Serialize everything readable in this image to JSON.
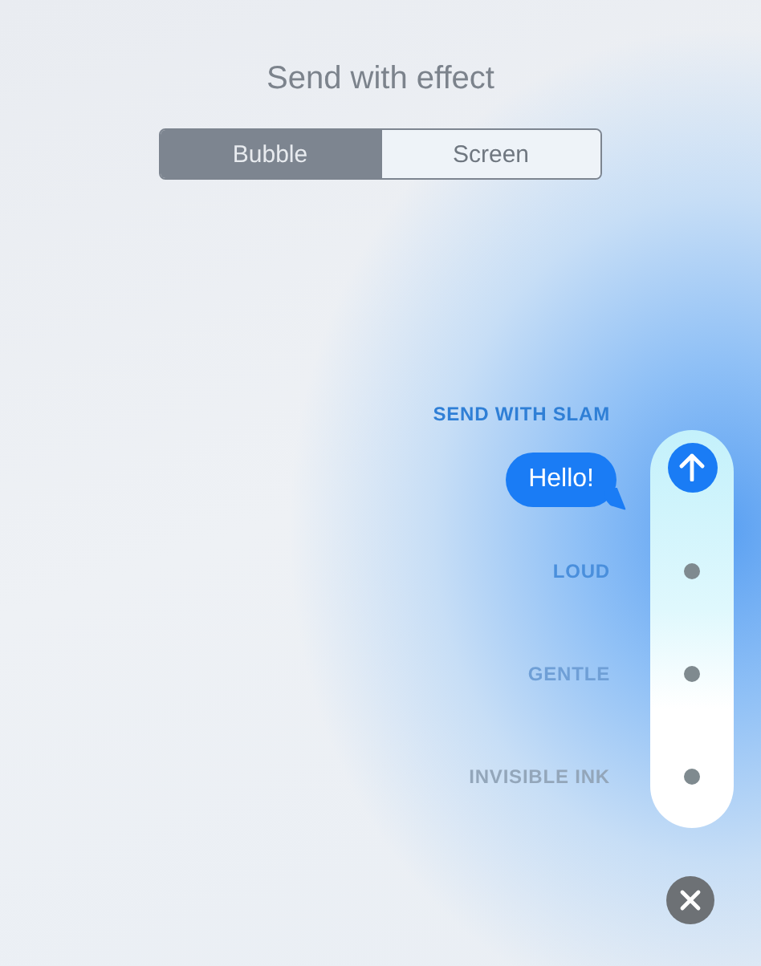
{
  "title": "Send with effect",
  "tabs": [
    {
      "label": "Bubble",
      "selected": true
    },
    {
      "label": "Screen",
      "selected": false
    }
  ],
  "effects": [
    {
      "label": "SEND WITH SLAM",
      "selected": true
    },
    {
      "label": "LOUD",
      "selected": false
    },
    {
      "label": "GENTLE",
      "selected": false
    },
    {
      "label": "INVISIBLE INK",
      "selected": false
    }
  ],
  "message": "Hello!"
}
